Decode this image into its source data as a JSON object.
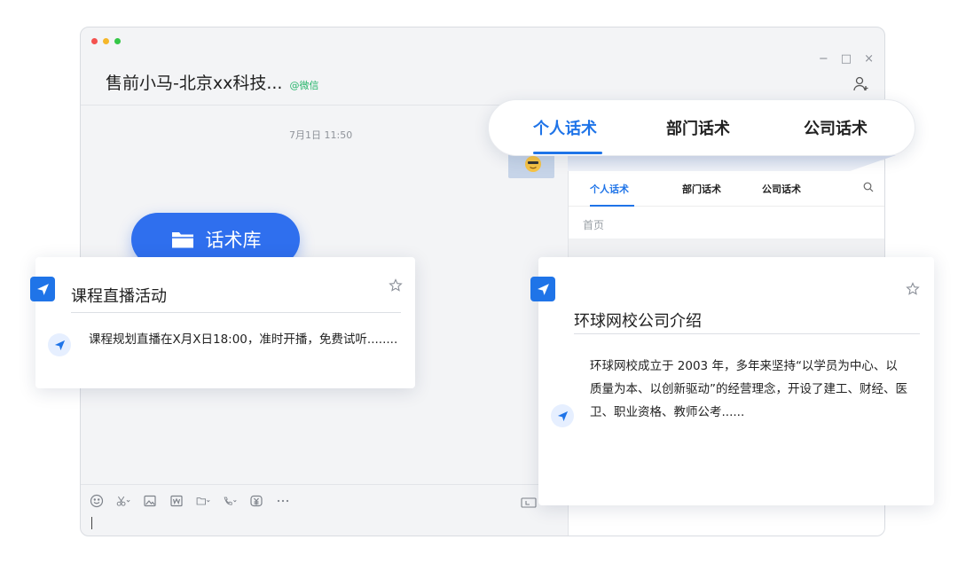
{
  "window": {
    "title": "售前小马-北京xx科技...",
    "source_tag": "@微信",
    "controls": {
      "minimize": "−",
      "maximize": "□",
      "close": "×"
    }
  },
  "chat": {
    "timestamp": "7月1日 11:50"
  },
  "top_tabs": {
    "items": [
      "个人话术",
      "部门话术",
      "公司话术"
    ],
    "active": 0
  },
  "side_panel": {
    "tabs": [
      "个人话术",
      "部门话术",
      "公司话术"
    ],
    "active": 0,
    "breadcrumb": "首页"
  },
  "library_button": {
    "label": "话术库"
  },
  "card_left": {
    "title": "课程直播活动",
    "body": "课程规划直播在X月X日18:00，准时开播，免费试听........"
  },
  "card_right": {
    "title": "环球网校公司介绍",
    "body": "环球网校成立于 2003 年，多年来坚持“以学员为中心、以质量为本、以创新驱动”的经营理念，开设了建工、财经、医卫、职业资格、教师公考......"
  },
  "colors": {
    "accent": "#1f74e8",
    "button": "#2f6fee",
    "wechat_tag": "#27b56b"
  },
  "icons": {
    "toolbar": [
      "emoji-icon",
      "scissors-icon",
      "image-icon",
      "word-doc-icon",
      "folder-icon",
      "phone-icon",
      "money-icon",
      "more-icon"
    ],
    "header": [
      "add-user-icon"
    ],
    "cards": [
      "send-arrow-icon",
      "star-icon"
    ]
  }
}
